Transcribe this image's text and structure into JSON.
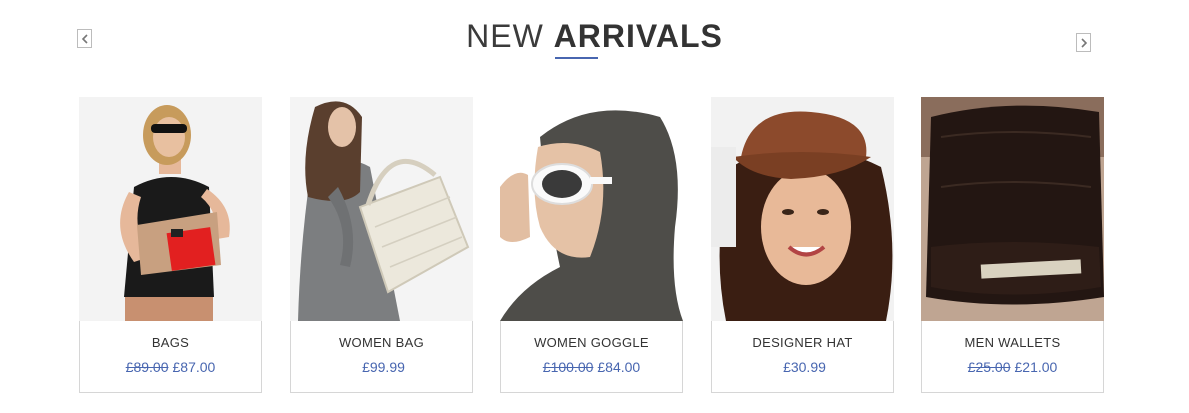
{
  "section": {
    "title_light": "NEW",
    "title_bold": "ARRIVALS",
    "accent_color": "#4866b0",
    "prev_icon": "chevron-left-icon",
    "next_icon": "chevron-right-icon"
  },
  "products": [
    {
      "name": "BAGS",
      "old_price": "£89.00",
      "price": "£87.00",
      "image": "woman-with-red-clutch-bag"
    },
    {
      "name": "WOMEN BAG",
      "old_price": "",
      "price": "£99.99",
      "image": "woman-with-cream-shoulder-bag"
    },
    {
      "name": "WOMEN GOGGLE",
      "old_price": "£100.00",
      "price": "£84.00",
      "image": "woman-in-white-sunglasses-hood"
    },
    {
      "name": "DESIGNER HAT",
      "old_price": "",
      "price": "£30.99",
      "image": "woman-in-brown-cap"
    },
    {
      "name": "MEN WALLETS",
      "old_price": "£25.00",
      "price": "£21.00",
      "image": "black-leather-wallet"
    }
  ]
}
